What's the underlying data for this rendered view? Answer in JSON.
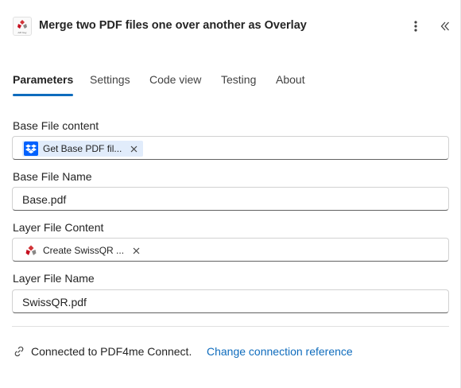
{
  "header": {
    "title": "Merge two PDF files one over another as Overlay",
    "logo_caption": "API Key",
    "more_icon": "more-vertical-icon",
    "collapse_icon": "double-chevron-left-icon"
  },
  "tabs": [
    {
      "label": "Parameters",
      "active": true
    },
    {
      "label": "Settings",
      "active": false
    },
    {
      "label": "Code view",
      "active": false
    },
    {
      "label": "Testing",
      "active": false
    },
    {
      "label": "About",
      "active": false
    }
  ],
  "fields": {
    "base_file_content": {
      "label": "Base File content",
      "token": {
        "label": "Get Base PDF fil...",
        "icon": "dropbox-icon"
      }
    },
    "base_file_name": {
      "label": "Base File Name",
      "value": "Base.pdf"
    },
    "layer_file_content": {
      "label": "Layer File Content",
      "token": {
        "label": "Create SwissQR ...",
        "icon": "pdf4me-icon"
      }
    },
    "layer_file_name": {
      "label": "Layer File Name",
      "value": "SwissQR.pdf"
    }
  },
  "connection": {
    "text": "Connected to PDF4me Connect.",
    "link": "Change connection reference",
    "icon": "link-icon"
  },
  "colors": {
    "accent": "#0f6cbd",
    "token_bg": "#e1ecfb",
    "dropbox": "#0061fe",
    "pdf4me_red": "#d13438"
  }
}
